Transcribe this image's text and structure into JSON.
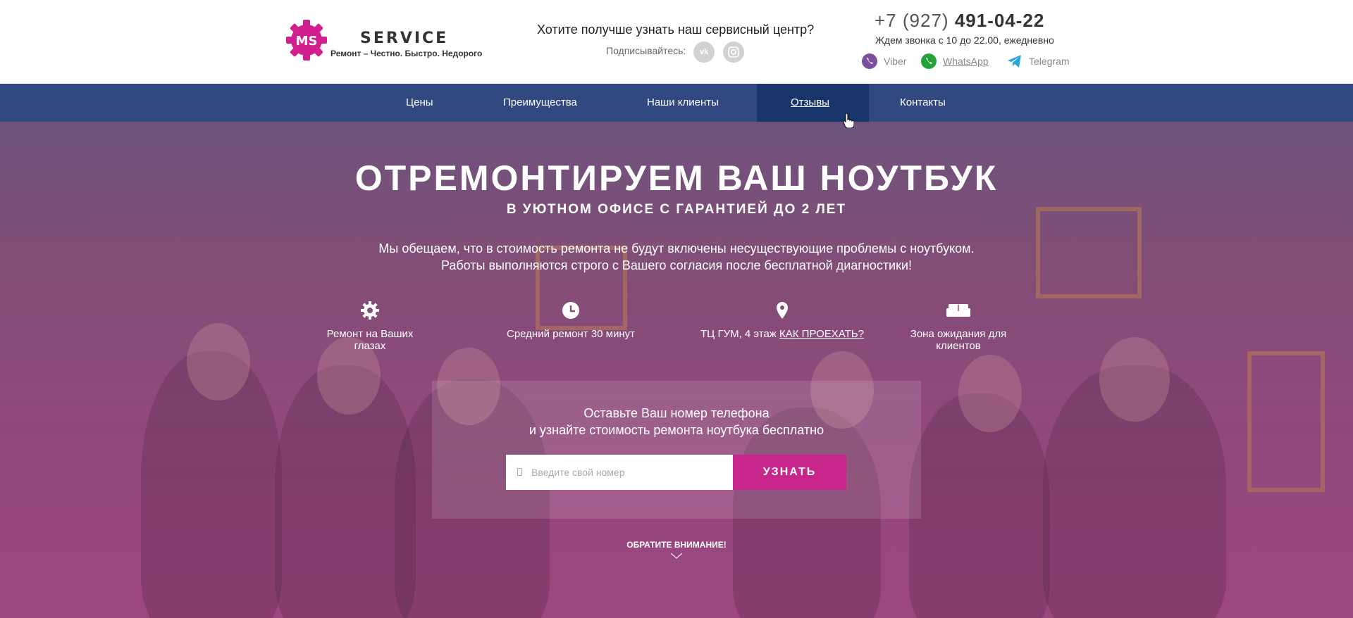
{
  "brand": {
    "logo_text": "MS",
    "name": "SERVICE",
    "tagline": "Ремонт – Честно. Быстро. Недорого"
  },
  "header": {
    "question": "Хотите получше узнать наш сервисный центр?",
    "subscribe_label": "Подписывайтесь:",
    "social": [
      {
        "name": "vk",
        "label": "vk"
      },
      {
        "name": "instagram",
        "label": "ig"
      }
    ],
    "phone_prefix": "+7 (927)",
    "phone_number": "491-04-22",
    "hours": "Ждем звонка с 10 до 22.00, ежедневно",
    "messengers": [
      {
        "label": "Viber",
        "color": "#7b519d"
      },
      {
        "label": "WhatsApp",
        "color": "#25a33a"
      },
      {
        "label": "Telegram",
        "color": "#2ca5e0"
      }
    ]
  },
  "nav": {
    "items": [
      "Цены",
      "Преимущества",
      "Наши клиенты",
      "Отзывы",
      "Контакты"
    ],
    "active": "Отзывы"
  },
  "hero": {
    "title": "ОТРЕМОНТИРУЕМ ВАШ НОУТБУК",
    "subtitle": "В УЮТНОМ ОФИСЕ С ГАРАНТИЕЙ ДО 2 ЛЕТ",
    "lead_line1": "Мы обещаем, что в стоимость ремонта не будут включены несуществующие проблемы с ноутбуком.",
    "lead_line2": "Работы выполняются строго с Вашего согласия после бесплатной диагностики!"
  },
  "features": [
    {
      "icon": "gear-icon",
      "text": "Ремонт на Ваших глазах"
    },
    {
      "icon": "clock-icon",
      "text": "Средний ремонт 30 минут"
    },
    {
      "icon": "map-pin-icon",
      "text": "ТЦ ГУМ, 4 этаж",
      "link": "КАК ПРОЕХАТЬ?"
    },
    {
      "icon": "sofa-icon",
      "text": "Зона ожидания для клиентов"
    }
  ],
  "form": {
    "title_line1": "Оставьте Ваш номер телефона",
    "title_line2": "и узнайте стоимость ремонта ноутбука бесплатно",
    "placeholder": "Введите свой номер",
    "button": "УЗНАТЬ"
  },
  "attention": "ОБРАТИТЕ ВНИМАНИЕ!",
  "colors": {
    "accent": "#c8268d",
    "nav_bg": "#1e4682"
  }
}
